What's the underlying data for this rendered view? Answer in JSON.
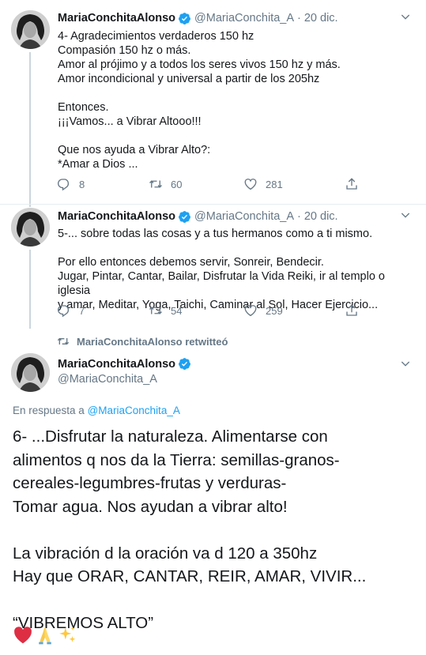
{
  "tweets": [
    {
      "name": "MariaConchitaAlonso",
      "handle": "@MariaConchita_A",
      "separator": "·",
      "time": "20 dic.",
      "text": "4- Agradecimientos verdaderos 150 hz\nCompasión 150 hz o más.\nAmor al prójimo y a todos los seres vivos 150 hz y más.\nAmor incondicional y universal a partir de los 205hz\n\nEntonces.\n¡¡¡Vamos... a Vibrar Altooo!!!\n\nQue nos ayuda a Vibrar Alto?:\n*Amar a Dios ...",
      "replies": "8",
      "retweets": "60",
      "likes": "281"
    },
    {
      "name": "MariaConchitaAlonso",
      "handle": "@MariaConchita_A",
      "separator": "·",
      "time": "20 dic.",
      "text": "5-... sobre todas las cosas y a tus hermanos como a ti mismo.\n\nPor ello entonces debemos servir, Sonreir, Bendecir.\nJugar, Pintar, Cantar, Bailar, Disfrutar la Vida Reiki, ir al templo o iglesia\ny amar, Meditar, Yoga, Taichi, Caminar al Sol, Hacer Ejercicio...",
      "replies": "7",
      "retweets": "54",
      "likes": "259"
    }
  ],
  "retweet_notice": "MariaConchitaAlonso retwitteó",
  "main_tweet": {
    "name": "MariaConchitaAlonso",
    "handle": "@MariaConchita_A",
    "reply_prefix": "En respuesta a",
    "reply_handle": "@MariaConchita_A",
    "text": "6- ...Disfrutar la naturaleza. Alimentarse con\nalimentos q nos da la Tierra: semillas-granos-\ncereales-legumbres-frutas y verduras-\nTomar agua. Nos ayudan a vibrar alto!\n\nLa vibración d la oración va d 120 a 350hz\nHay que ORAR, CANTAR, REIR, AMAR, VIVIR...\n\n“VIBREMOS ALTO”"
  },
  "emojis": [
    "red-heart",
    "folded-hands",
    "sparkles"
  ],
  "colors": {
    "verified": "#1da1f2",
    "link": "#1da1f2",
    "secondary_text": "#657786",
    "divider": "#e6ecf0"
  }
}
